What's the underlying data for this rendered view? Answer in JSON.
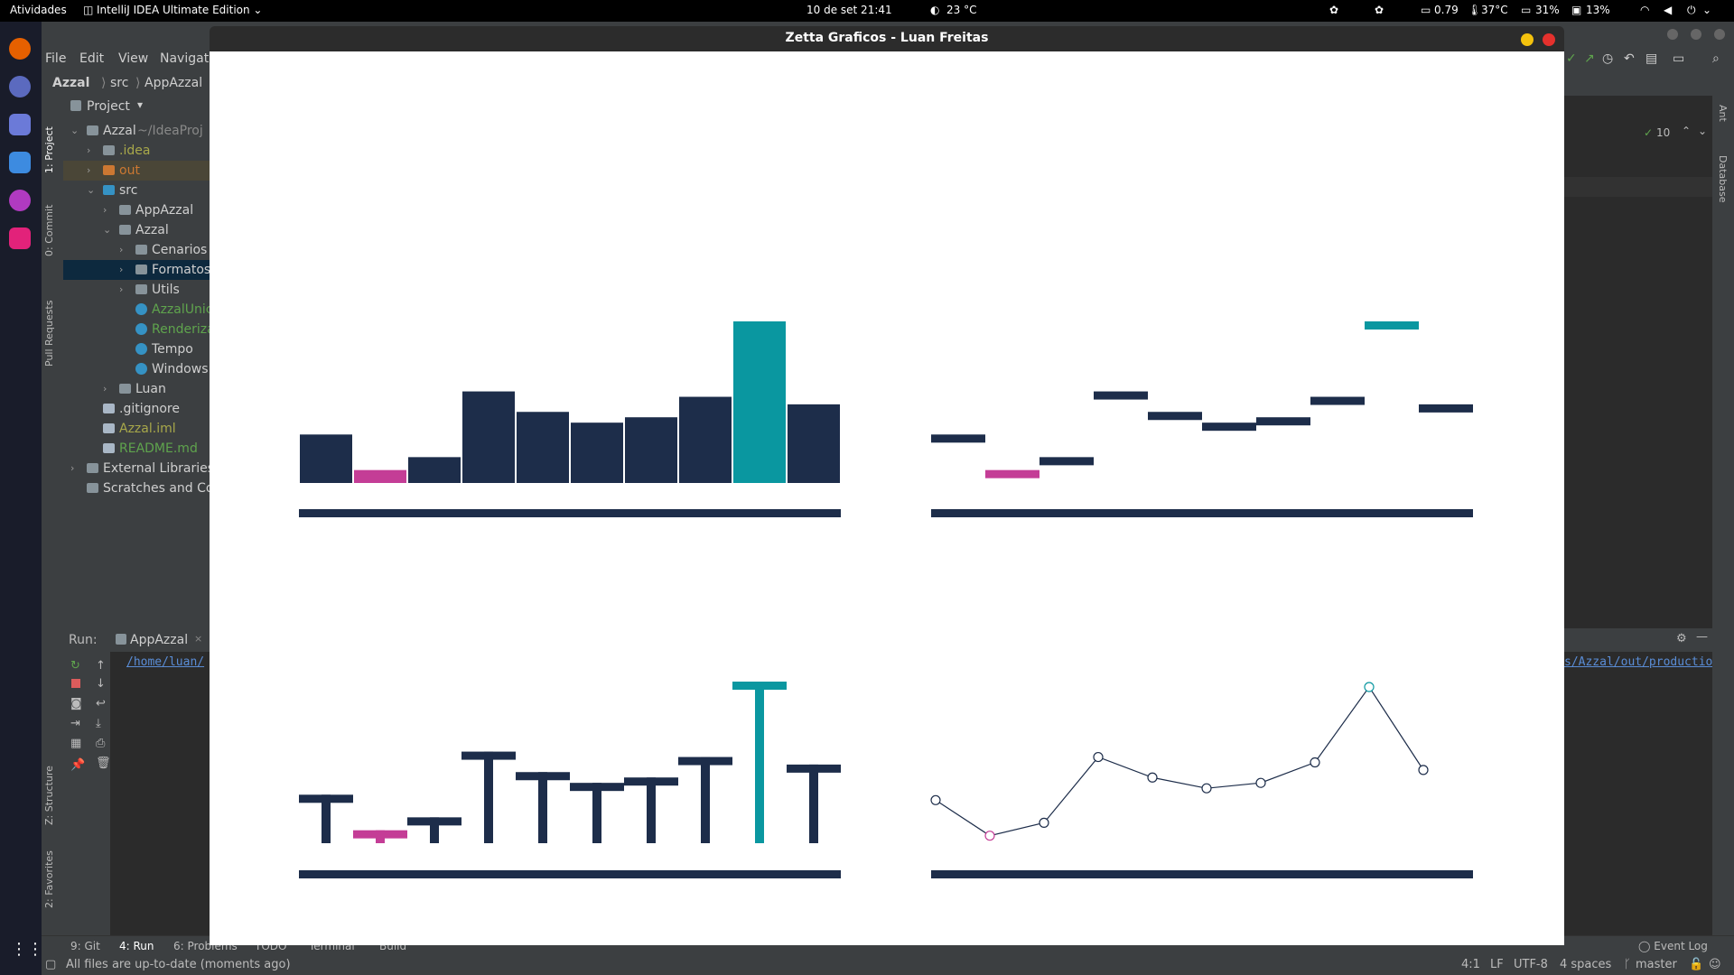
{
  "topbar": {
    "activities": "Atividades",
    "app_name": "IntelliJ IDEA Ultimate Edition",
    "clock": "10 de set  21:41",
    "weather": "23 °C",
    "load": "0.79",
    "temp": "37°C",
    "disk": "31%",
    "cpu": "13%"
  },
  "zetta": {
    "title": "Zetta Graficos - Luan Freitas"
  },
  "ide": {
    "menu": [
      "File",
      "Edit",
      "View",
      "Navigat"
    ],
    "breadcrumb": [
      "Azzal",
      "src",
      "AppAzzal"
    ],
    "project_label": "Project",
    "left_tabs": [
      "1: Project",
      "0: Commit",
      "Pull Requests",
      "Z: Structure",
      "2: Favorites"
    ],
    "right_tabs": [
      "Ant",
      "Database"
    ],
    "tree": [
      {
        "depth": 0,
        "label": "Azzal",
        "suffix": " ~/IdeaProj",
        "kind": "folder",
        "chevron": "open",
        "color": "#cfcfcf"
      },
      {
        "depth": 1,
        "label": ".idea",
        "kind": "folder",
        "chevron": "closed",
        "color": "#a8a84a"
      },
      {
        "depth": 1,
        "label": "out",
        "kind": "folder-orange",
        "chevron": "closed",
        "color": "#cc7832"
      },
      {
        "depth": 1,
        "label": "src",
        "kind": "folder-blue",
        "chevron": "open",
        "color": "#cfcfcf"
      },
      {
        "depth": 2,
        "label": "AppAzzal",
        "kind": "folder",
        "chevron": "closed",
        "color": "#cfcfcf"
      },
      {
        "depth": 2,
        "label": "Azzal",
        "kind": "folder",
        "chevron": "open",
        "color": "#cfcfcf"
      },
      {
        "depth": 3,
        "label": "Cenarios",
        "kind": "folder",
        "chevron": "closed",
        "color": "#cfcfcf"
      },
      {
        "depth": 3,
        "label": "Formatos",
        "kind": "folder",
        "chevron": "closed",
        "color": "#cfcfcf"
      },
      {
        "depth": 3,
        "label": "Utils",
        "kind": "folder",
        "chevron": "closed",
        "color": "#cfcfcf"
      },
      {
        "depth": 3,
        "label": "AzzalUnic",
        "kind": "class",
        "chevron": "none",
        "color": "#5fa44d"
      },
      {
        "depth": 3,
        "label": "Renderiza",
        "kind": "class",
        "chevron": "none",
        "color": "#5fa44d"
      },
      {
        "depth": 3,
        "label": "Tempo",
        "kind": "class",
        "chevron": "none",
        "color": "#cfcfcf"
      },
      {
        "depth": 3,
        "label": "Windows",
        "kind": "class",
        "chevron": "none",
        "color": "#cfcfcf"
      },
      {
        "depth": 2,
        "label": "Luan",
        "kind": "folder",
        "chevron": "closed",
        "color": "#cfcfcf"
      },
      {
        "depth": 1,
        "label": ".gitignore",
        "kind": "file",
        "chevron": "none",
        "color": "#cfcfcf"
      },
      {
        "depth": 1,
        "label": "Azzal.iml",
        "kind": "file",
        "chevron": "none",
        "color": "#a8a84a"
      },
      {
        "depth": 1,
        "label": "README.md",
        "kind": "file",
        "chevron": "none",
        "color": "#5fa44d"
      },
      {
        "depth": 0,
        "label": "External Libraries",
        "kind": "lib",
        "chevron": "closed",
        "color": "#cfcfcf"
      },
      {
        "depth": 0,
        "label": "Scratches and Co",
        "kind": "scratch",
        "chevron": "none",
        "color": "#cfcfcf"
      }
    ],
    "run_label": "Run:",
    "run_tab": "AppAzzal",
    "run_path": "/home/luan/",
    "run_path_right": "s/Azzal/out/productio",
    "editor_counter": "10",
    "bottom_tabs": [
      "9: Git",
      "4: Run",
      "6: Problems",
      "TODO",
      "Terminal",
      "Build"
    ],
    "event_log": "Event Log",
    "status_message": "All files are up-to-date (moments ago)",
    "status_right": [
      "4:1",
      "LF",
      "UTF-8",
      "4 spaces",
      "master"
    ]
  },
  "colors": {
    "navy": "#1d2d4a",
    "magenta": "#c43d96",
    "teal": "#0a97a0"
  },
  "chart_data": [
    {
      "type": "bar",
      "values": [
        45,
        12,
        24,
        85,
        66,
        56,
        61,
        80,
        150,
        73
      ],
      "highlight_min": 1,
      "highlight_max": 8,
      "ylim": [
        0,
        150
      ],
      "grid": false
    },
    {
      "type": "scatter",
      "marker": "horizontal-dash",
      "values": [
        45,
        12,
        24,
        85,
        66,
        56,
        61,
        80,
        150,
        73
      ],
      "highlight_min": 1,
      "highlight_max": 8,
      "ylim": [
        0,
        150
      ],
      "grid": false
    },
    {
      "type": "bar",
      "marker": "t-bar",
      "values": [
        45,
        12,
        24,
        85,
        66,
        56,
        61,
        80,
        150,
        73
      ],
      "highlight_min": 1,
      "highlight_max": 8,
      "ylim": [
        0,
        150
      ],
      "grid": false
    },
    {
      "type": "line",
      "marker": "hollow-circle",
      "values": [
        45,
        12,
        24,
        85,
        66,
        56,
        61,
        80,
        150,
        73
      ],
      "highlight_min": 1,
      "highlight_max": 8,
      "ylim": [
        0,
        150
      ],
      "grid": false
    }
  ]
}
